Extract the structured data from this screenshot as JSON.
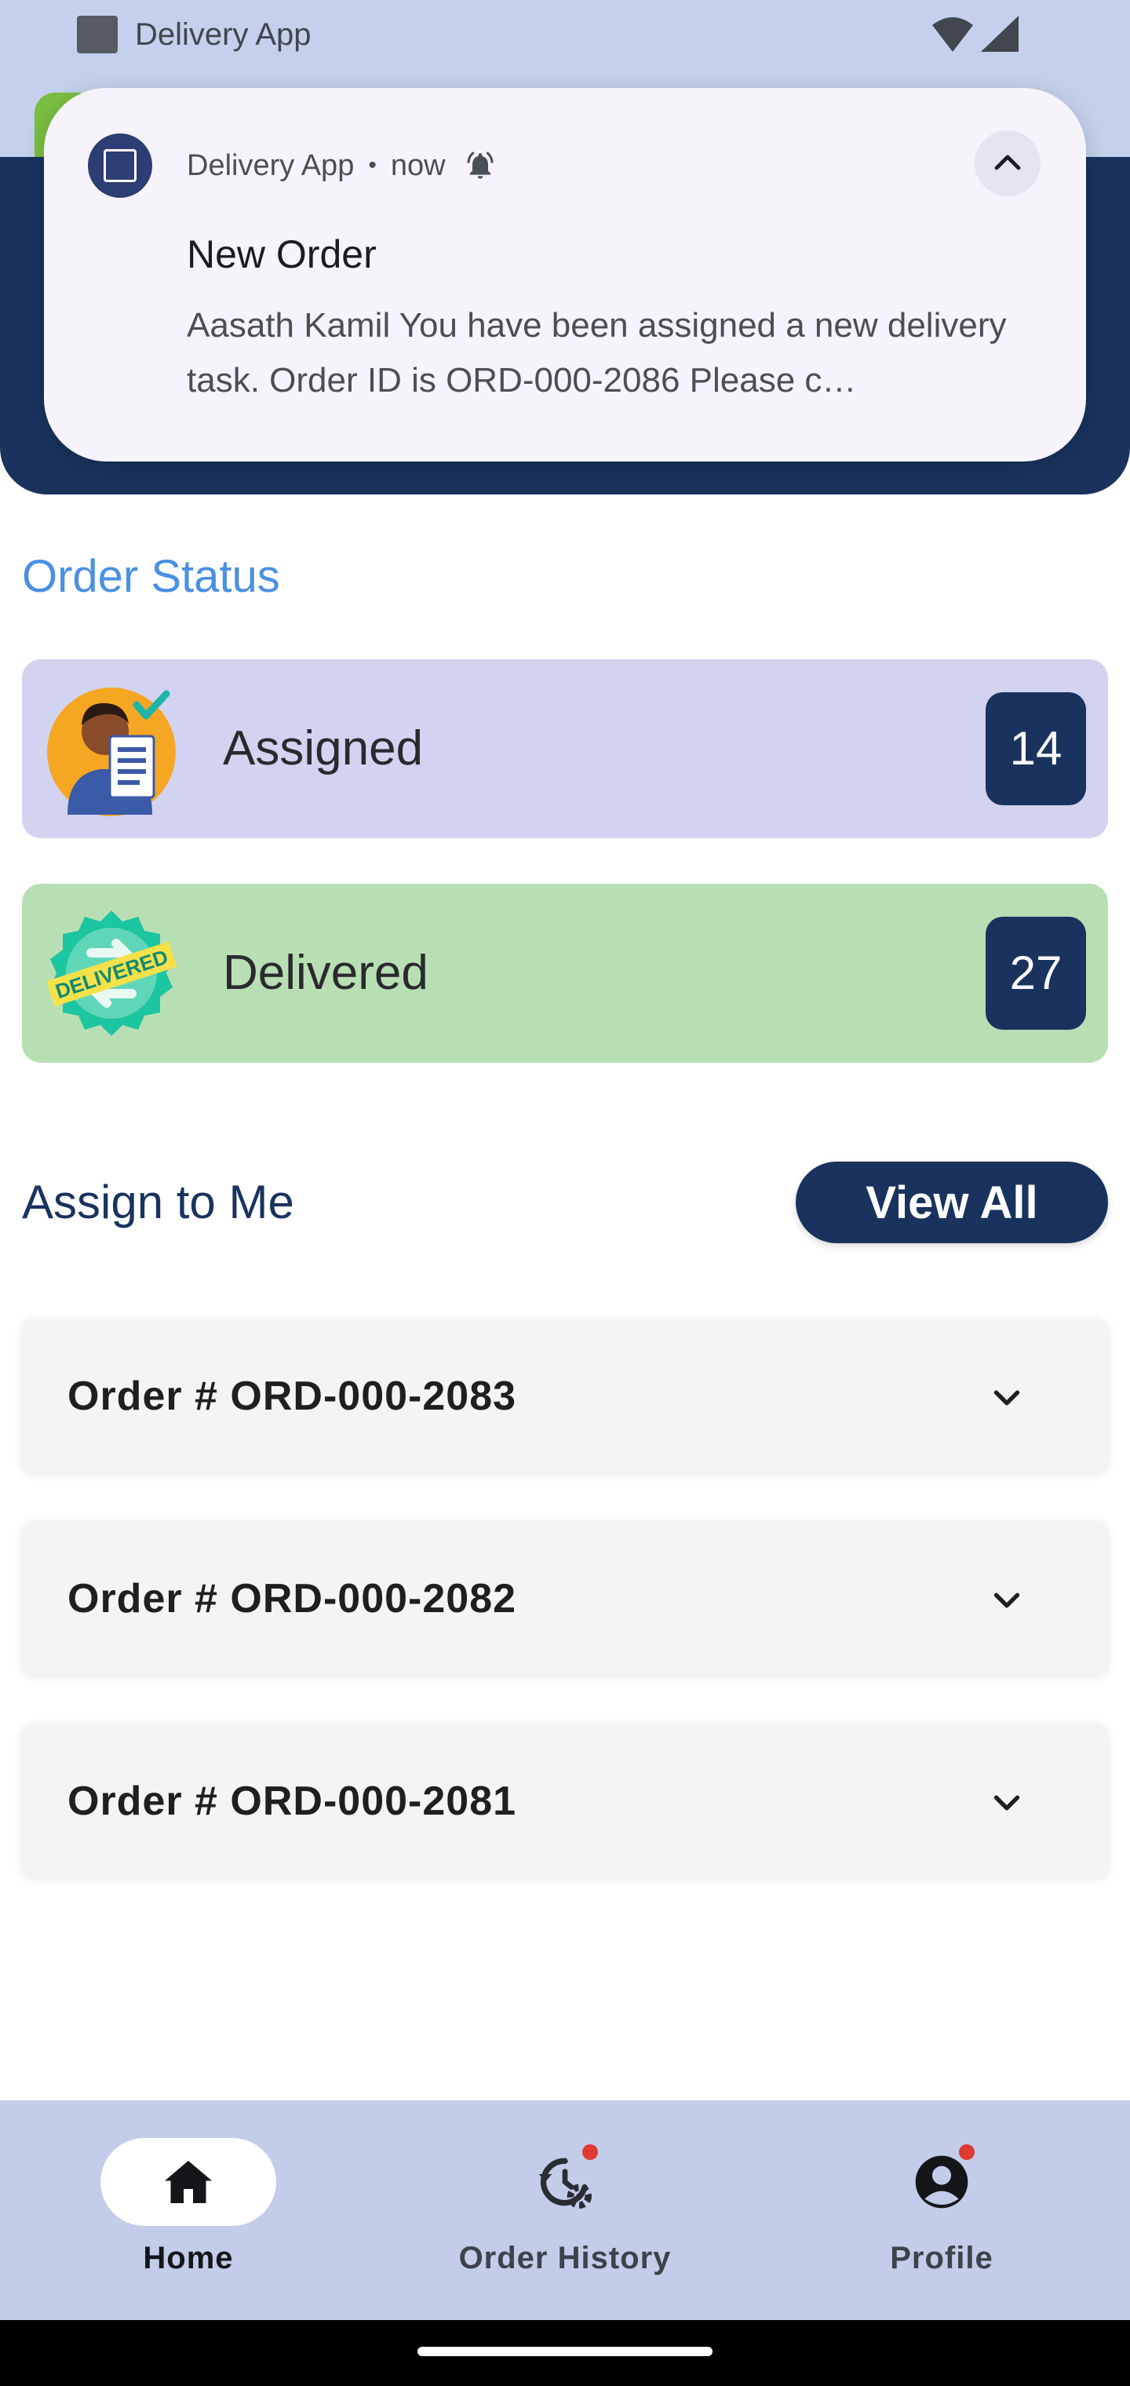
{
  "status_bar": {
    "app_name": "Delivery App"
  },
  "notification": {
    "app_name": "Delivery App",
    "separator": "•",
    "time": "now",
    "title": "New Order",
    "body": "Aasath Kamil You have been assigned a new delivery task. Order ID is ORD-000-2086 Please c…"
  },
  "order_status": {
    "title": "Order Status",
    "cards": [
      {
        "label": "Assigned",
        "count": "14",
        "color": "#d2d3f1",
        "icon": "assigned-person-icon"
      },
      {
        "label": "Delivered",
        "count": "27",
        "color": "#b8dfb4",
        "icon": "delivered-badge-icon"
      }
    ],
    "badge_text": "DELIVERED"
  },
  "assign": {
    "title": "Assign to Me",
    "view_all": "View All",
    "orders": [
      {
        "title": "Order # ORD-000-2083"
      },
      {
        "title": "Order # ORD-000-2082"
      },
      {
        "title": "Order # ORD-000-2081"
      }
    ]
  },
  "bottom_nav": {
    "items": [
      {
        "label": "Home",
        "icon": "home-icon",
        "active": true
      },
      {
        "label": "Order History",
        "icon": "history-settings-icon",
        "active": false
      },
      {
        "label": "Profile",
        "icon": "account-circle-icon",
        "active": false
      }
    ]
  },
  "colors": {
    "primary": "#19335e",
    "accent_blue": "#4a90e2",
    "nav_bg": "#c3cdea",
    "badge": "#e03b32"
  }
}
